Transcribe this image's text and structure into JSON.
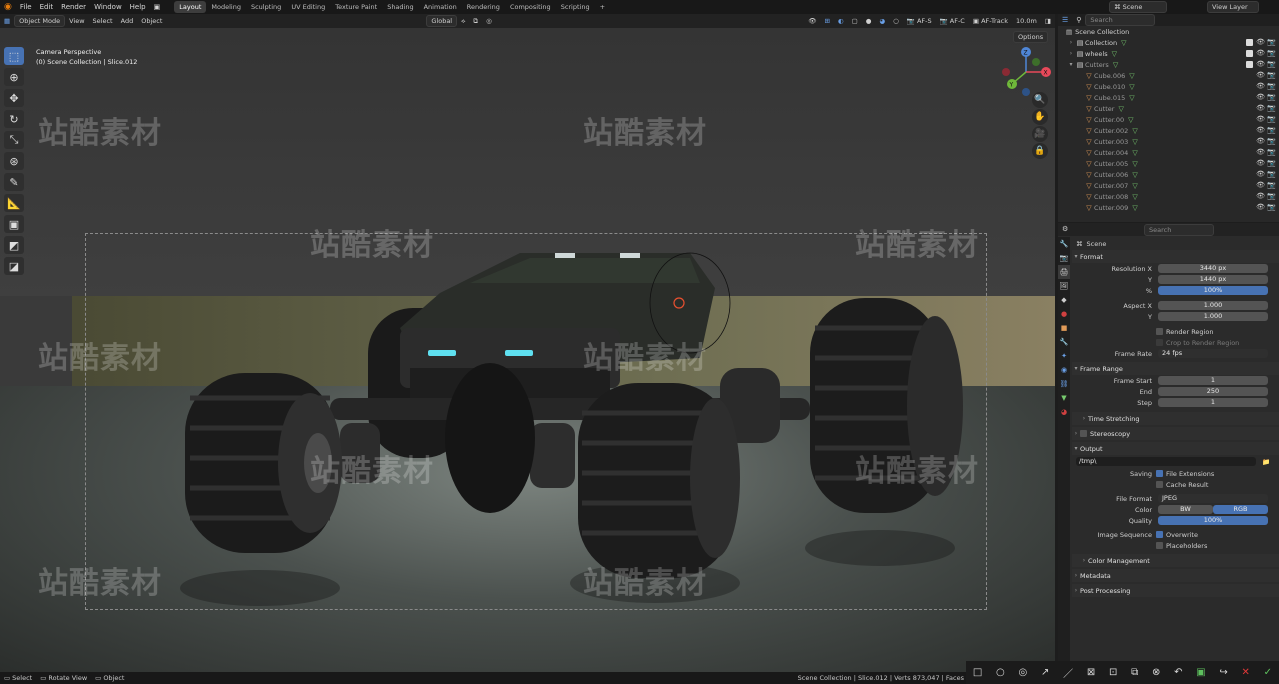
{
  "app": {
    "logo": "blender-logo-icon"
  },
  "menu": [
    "File",
    "Edit",
    "Render",
    "Window",
    "Help"
  ],
  "workspaces": [
    "Layout",
    "Modeling",
    "Sculpting",
    "UV Editing",
    "Texture Paint",
    "Shading",
    "Animation",
    "Rendering",
    "Compositing",
    "Scripting"
  ],
  "active_workspace": "Layout",
  "scene_selector": "Scene",
  "view_layer_selector": "View Layer",
  "header": {
    "mode": "Object Mode",
    "view": "View",
    "select": "Select",
    "add": "Add",
    "object": "Object",
    "transform_orientation": "Global",
    "af_s": "AF-S",
    "af_c": "AF-C",
    "af_track": "AF-Track",
    "distance": "10.0m",
    "options": "Options"
  },
  "viewport": {
    "info_line1": "Camera Perspective",
    "info_line2": "(0) Scene Collection | Slice.012"
  },
  "gizmo": {
    "x": "X",
    "y": "Y",
    "z": "Z"
  },
  "watermark": "站酷素材",
  "outliner": {
    "search_placeholder": "Search",
    "root": "Scene Collection",
    "items": [
      {
        "label": "Collection",
        "indent": 1,
        "dim": false
      },
      {
        "label": "wheels",
        "indent": 1,
        "dim": false
      },
      {
        "label": "Cutters",
        "indent": 1,
        "dim": true
      },
      {
        "label": "Cube.006",
        "indent": 2,
        "dim": true
      },
      {
        "label": "Cube.010",
        "indent": 2,
        "dim": true
      },
      {
        "label": "Cube.015",
        "indent": 2,
        "dim": true
      },
      {
        "label": "Cutter",
        "indent": 2,
        "dim": true
      },
      {
        "label": "Cutter.00",
        "indent": 2,
        "dim": true
      },
      {
        "label": "Cutter.002",
        "indent": 2,
        "dim": true
      },
      {
        "label": "Cutter.003",
        "indent": 2,
        "dim": true
      },
      {
        "label": "Cutter.004",
        "indent": 2,
        "dim": true
      },
      {
        "label": "Cutter.005",
        "indent": 2,
        "dim": true
      },
      {
        "label": "Cutter.006",
        "indent": 2,
        "dim": true
      },
      {
        "label": "Cutter.007",
        "indent": 2,
        "dim": true
      },
      {
        "label": "Cutter.008",
        "indent": 2,
        "dim": true
      },
      {
        "label": "Cutter.009",
        "indent": 2,
        "dim": true
      }
    ]
  },
  "properties": {
    "search_placeholder": "Search",
    "context": "Scene",
    "format": {
      "title": "Format",
      "res_x_label": "Resolution X",
      "res_x": "3440 px",
      "res_y_label": "Y",
      "res_y": "1440 px",
      "pct_label": "%",
      "pct": "100%",
      "aspect_x_label": "Aspect X",
      "aspect_x": "1.000",
      "aspect_y_label": "Y",
      "aspect_y": "1.000",
      "render_region": "Render Region",
      "crop": "Crop to Render Region",
      "frame_rate_label": "Frame Rate",
      "frame_rate": "24 fps"
    },
    "frame_range": {
      "title": "Frame Range",
      "start_label": "Frame Start",
      "start": "1",
      "end_label": "End",
      "end": "250",
      "step_label": "Step",
      "step": "1",
      "time_stretching": "Time Stretching",
      "stereoscopy": "Stereoscopy"
    },
    "output": {
      "title": "Output",
      "path": "/tmp\\",
      "saving_label": "Saving",
      "file_extensions": "File Extensions",
      "cache_result": "Cache Result",
      "file_format_label": "File Format",
      "file_format": "JPEG",
      "color_label": "Color",
      "bw": "BW",
      "rgb": "RGB",
      "quality_label": "Quality",
      "quality": "100%",
      "image_sequence_label": "Image Sequence",
      "overwrite": "Overwrite",
      "placeholders": "Placeholders",
      "color_management": "Color Management"
    },
    "metadata": "Metadata",
    "post_processing": "Post Processing"
  },
  "status": {
    "select": "Select",
    "rotate_view": "Rotate View",
    "object": "Object",
    "info": "Scene Collection | Slice.012 | Verts 873,047 | Faces"
  },
  "colors": {
    "accent": "#4772b3",
    "mesh": "#e09a58",
    "data": "#76c86e",
    "x_axis": "#e8495a",
    "y_axis": "#6fb83a",
    "z_axis": "#4f86d6"
  }
}
